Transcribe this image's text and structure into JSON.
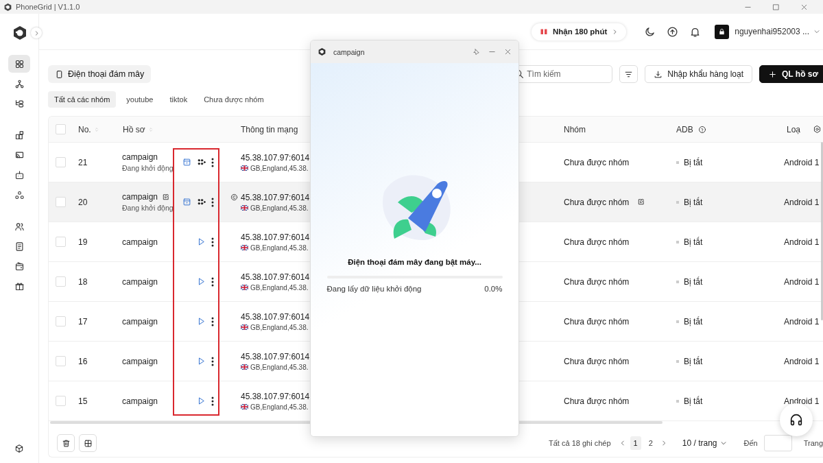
{
  "app": {
    "title": "PhoneGrid | V1.1.0"
  },
  "sidebar": {
    "items": [
      {
        "selected": true
      },
      {
        "selected": false
      },
      {
        "selected": false
      },
      {
        "selected": false
      },
      {
        "selected": false
      },
      {
        "selected": false
      },
      {
        "selected": false
      },
      {
        "selected": false
      },
      {
        "selected": false
      },
      {
        "selected": false
      },
      {
        "selected": false
      }
    ]
  },
  "topbar": {
    "promo": "Nhận 180 phút",
    "account": "nguyenhai952003 ..."
  },
  "toolbar": {
    "view_tab": "Điện thoại đám mây",
    "search": {
      "placeholder": "Tìm kiếm"
    },
    "buttons": [
      {
        "kind": "import",
        "label": "Nhập khẩu hàng loạt"
      },
      {
        "kind": "create",
        "label": "QL hồ sơ"
      }
    ]
  },
  "group_tabs": [
    {
      "label": "Tất cả các nhóm",
      "selected": true
    },
    {
      "label": "youtube",
      "selected": false
    },
    {
      "label": "tiktok",
      "selected": false
    },
    {
      "label": "Chưa được nhóm",
      "selected": false
    }
  ],
  "table": {
    "select_all": {
      "checked": false
    },
    "columns": [
      "No.",
      "Hồ sơ",
      "Thông tin mạng",
      "Nhóm",
      "ADB",
      "Loạ"
    ],
    "rows": [
      {
        "checked": false,
        "highlighted": false,
        "kind": "running",
        "no": "21",
        "profile": "campaign",
        "status": "Đang khởi động",
        "ip": "45.38.107.97:6014",
        "location": "GB,England,45.38.",
        "group": "Chưa được nhóm",
        "adb": "Bị tắt",
        "type": "Android 1"
      },
      {
        "checked": false,
        "highlighted": true,
        "kind": "running",
        "no": "20",
        "profile": "campaign",
        "status": "Đang khởi động",
        "ip": "45.38.107.97:6014",
        "location": "GB,England,45.38.",
        "group": "Chưa được nhóm",
        "adb": "Bị tắt",
        "type": "Android 1"
      },
      {
        "checked": false,
        "highlighted": false,
        "kind": "stopped",
        "no": "19",
        "profile": "campaign",
        "ip": "45.38.107.97:6014",
        "location": "GB,England,45.38.",
        "group": "Chưa được nhóm",
        "adb": "Bị tắt",
        "type": "Android 1"
      },
      {
        "checked": false,
        "highlighted": false,
        "kind": "stopped",
        "no": "18",
        "profile": "campaign",
        "ip": "45.38.107.97:6014",
        "location": "GB,England,45.38.",
        "group": "Chưa được nhóm",
        "adb": "Bị tắt",
        "type": "Android 1"
      },
      {
        "checked": false,
        "highlighted": false,
        "kind": "stopped",
        "no": "17",
        "profile": "campaign",
        "ip": "45.38.107.97:6014",
        "location": "GB,England,45.38.",
        "group": "Chưa được nhóm",
        "adb": "Bị tắt",
        "type": "Android 1"
      },
      {
        "checked": false,
        "highlighted": false,
        "kind": "stopped",
        "no": "16",
        "profile": "campaign",
        "ip": "45.38.107.97:6014",
        "location": "GB,England,45.38.",
        "group": "Chưa được nhóm",
        "adb": "Bị tắt",
        "type": "Android 1"
      },
      {
        "checked": false,
        "highlighted": false,
        "kind": "stopped",
        "no": "15",
        "profile": "campaign",
        "ip": "45.38.107.97:6014",
        "location": "GB,England,45.38.",
        "group": "Chưa được nhóm",
        "adb": "Bị tắt",
        "type": "Android 1"
      }
    ]
  },
  "footer": {
    "total": "Tất cả 18 ghi chép",
    "pages": [
      {
        "label": "1",
        "selected": true
      },
      {
        "label": "2",
        "selected": false
      }
    ],
    "page_size": "10 / trang",
    "goto_label": "Đến",
    "goto_suffix": "Trang"
  },
  "dialog": {
    "title": "campaign",
    "message": "Điện thoại đám mây đang bật máy...",
    "progress": {
      "level": 0,
      "label": "Đang lấy dữ liệu khởi động",
      "reading": "0.0%"
    }
  }
}
